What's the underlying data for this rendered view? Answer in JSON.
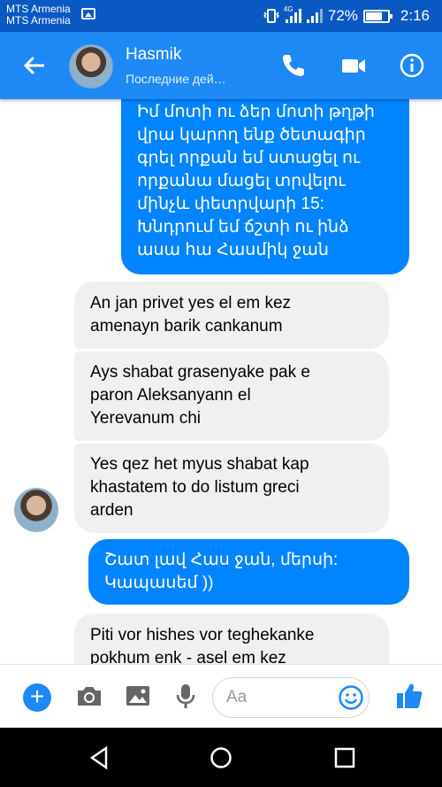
{
  "status_bar": {
    "carrier_1": "MTS Armenia",
    "carrier_2": "MTS Armenia",
    "network": "4G",
    "battery": "72%",
    "time": "2:16"
  },
  "header": {
    "contact_name": "Hasmik",
    "status": "Последние дей…",
    "icons": [
      "back-arrow-icon",
      "phone-icon",
      "video-camera-icon",
      "info-icon"
    ]
  },
  "messages": [
    {
      "direction": "outgoing",
      "lines": [
        "Իմ մոտի ու ձեր մոտի թղթի",
        "վրա կարող ենք ծետագիր",
        "գրել որքան եմ ստացել ու",
        "որքանա մացել տրվելու",
        "մինչև փետրվարի 15:",
        "Խնդրում եմ ճշտի ու ինձ",
        "ասա հա Հասմիկ ջան"
      ]
    },
    {
      "direction": "incoming",
      "lines": [
        "An jan privet yes el em kez",
        "amenayn barik cankanum"
      ]
    },
    {
      "direction": "incoming",
      "lines": [
        "Ays shabat grasenyake pak e",
        "paron Aleksanyann el",
        "Yerevanum chi"
      ]
    },
    {
      "direction": "incoming",
      "lines": [
        "Yes qez het myus shabat kap",
        "khastatem to do listum greci",
        "arden"
      ]
    },
    {
      "direction": "outgoing",
      "lines": [
        "Շատ լավ Հաս ջան, մերսի:",
        "Կապասեմ ))"
      ]
    },
    {
      "direction": "incoming",
      "lines": [
        "Piti vor hishes vor teghekanke",
        "pokhum enk - asel em kez"
      ]
    }
  ],
  "composer": {
    "placeholder": "Aa",
    "icons": [
      "plus-icon",
      "camera-icon",
      "gallery-icon",
      "microphone-icon",
      "emoji-icon",
      "thumbs-up-icon"
    ]
  },
  "colors": {
    "status_bar": "#0a58c2",
    "header": "#1e88f5",
    "outgoing_bubble": "#0084ff",
    "incoming_bubble": "#f1f0f0"
  }
}
